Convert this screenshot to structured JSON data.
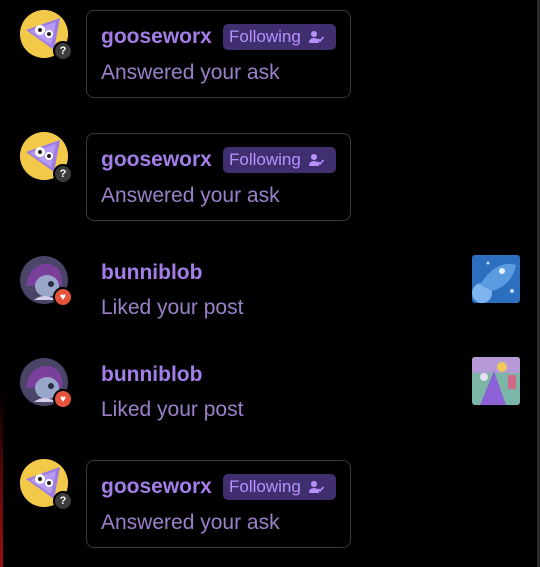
{
  "notifications": [
    {
      "type": "ask",
      "username": "gooseworx",
      "following_label": "Following",
      "message": "Answered your ask",
      "badge_icon": "?"
    },
    {
      "type": "ask",
      "username": "gooseworx",
      "following_label": "Following",
      "message": "Answered your ask",
      "badge_icon": "?"
    },
    {
      "type": "like",
      "username": "bunniblob",
      "message": "Liked your post",
      "badge_icon": "heart-icon"
    },
    {
      "type": "like",
      "username": "bunniblob",
      "message": "Liked your post",
      "badge_icon": "heart-icon"
    },
    {
      "type": "ask",
      "username": "gooseworx",
      "following_label": "Following",
      "message": "Answered your ask",
      "badge_icon": "?"
    }
  ],
  "colors": {
    "background": "#000000",
    "username": "#a47ee8",
    "message": "#9b80c9",
    "following_bg": "#3f2f6f",
    "following_text": "#b891ff",
    "like_badge": "#e5533d",
    "ask_badge": "#3c3c3c"
  }
}
